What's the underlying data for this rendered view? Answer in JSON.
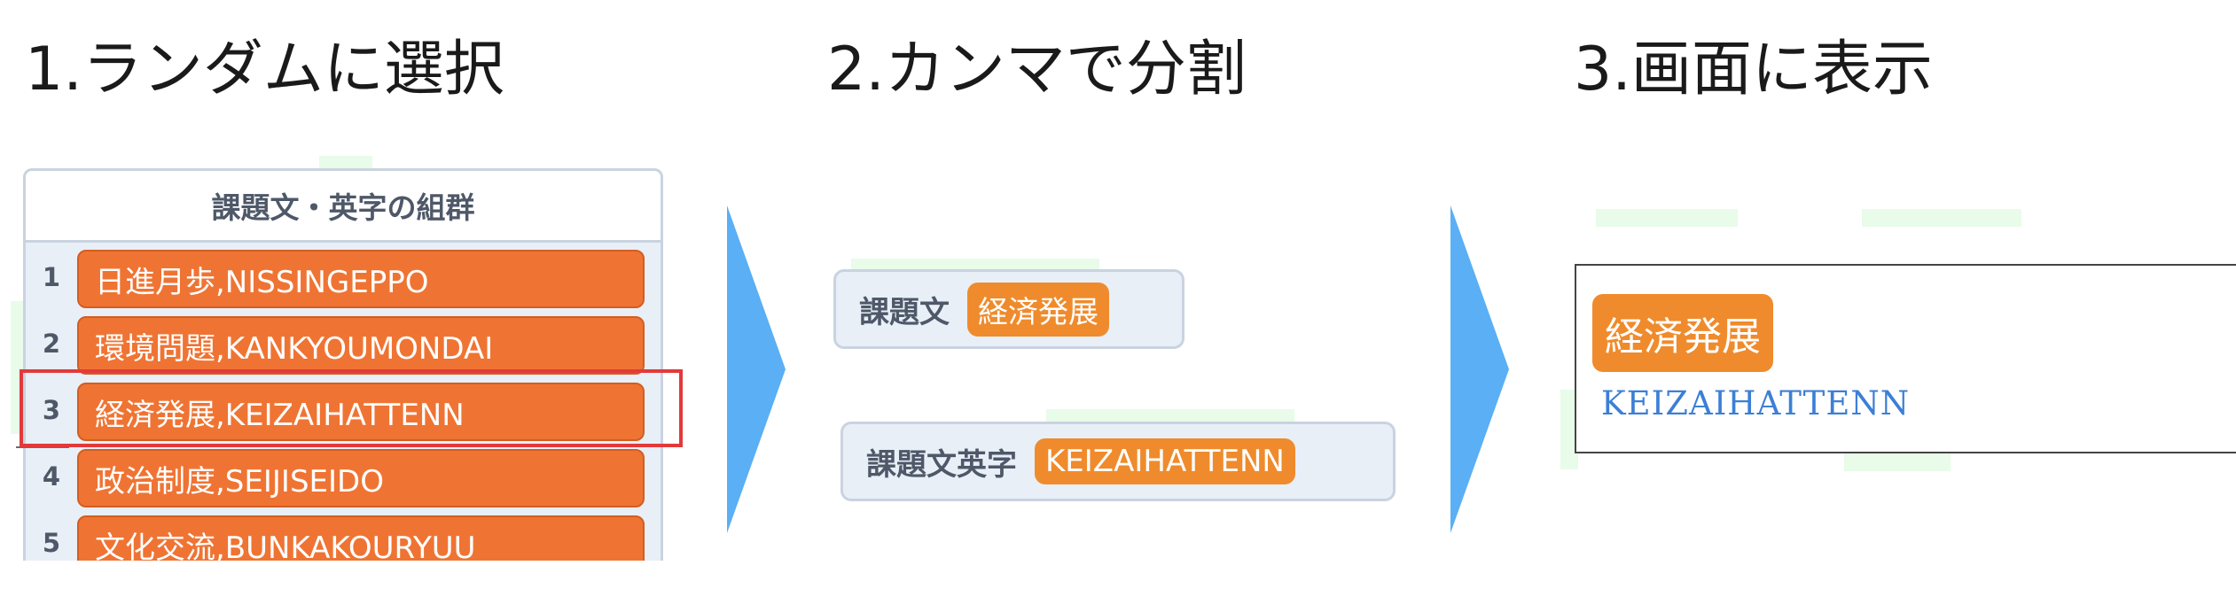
{
  "steps": [
    {
      "title": "1.ランダムに選択"
    },
    {
      "title": "2.カンマで分割"
    },
    {
      "title": "3.画面に表示"
    }
  ],
  "list": {
    "header": "課題文・英字の組群",
    "rows": [
      {
        "index": "1",
        "text": "日進月歩,NISSINGEPPO"
      },
      {
        "index": "2",
        "text": "環境問題,KANKYOUMONDAI"
      },
      {
        "index": "3",
        "text": "経済発展,KEIZAIHATTENN"
      },
      {
        "index": "4",
        "text": "政治制度,SEIJISEIDO"
      },
      {
        "index": "5",
        "text": "文化交流,BUNKAKOURYUU"
      }
    ],
    "selected_index": "3"
  },
  "split": {
    "reporter1": {
      "label": "課題文",
      "value": "経済発展"
    },
    "reporter2": {
      "label": "課題文英字",
      "value": "KEIZAIHATTENN"
    }
  },
  "display": {
    "word": "経済発展",
    "romaji": "KEIZAIHATTENN"
  },
  "colors": {
    "block_orange": "#ef7433",
    "pill_orange": "#ef8b2c",
    "arrow_blue": "#5aaff5",
    "highlight_red": "#e23a3a",
    "romaji_blue": "#3c7fd6"
  }
}
